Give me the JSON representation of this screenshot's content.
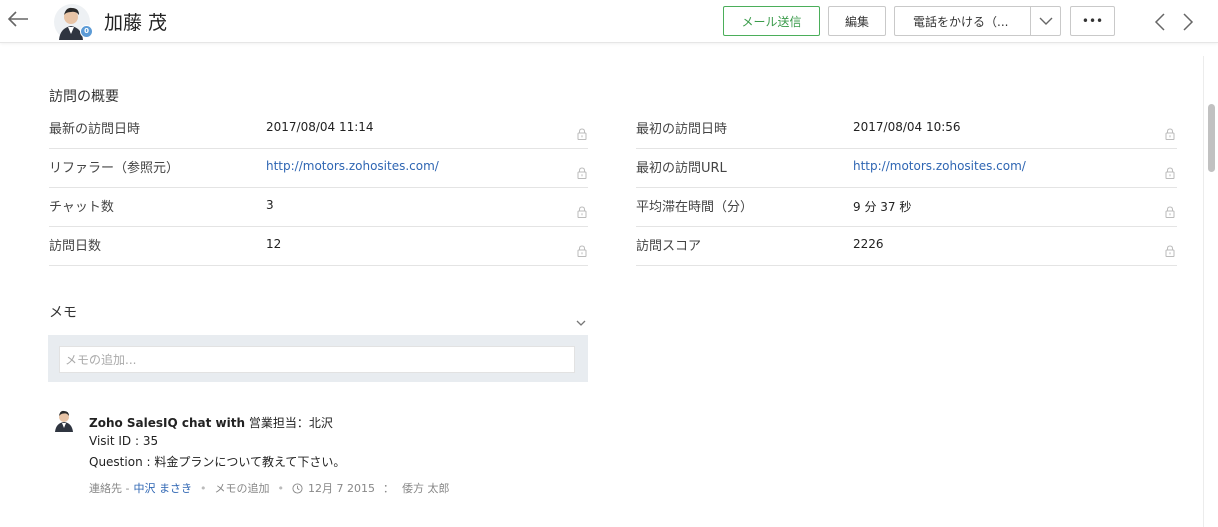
{
  "header": {
    "contact_name": "加藤 茂",
    "avatar_badge": "0",
    "send_mail_label": "メール送信",
    "edit_label": "編集",
    "call_label": "電話をかける（...",
    "more_label": "•••"
  },
  "visit_summary": {
    "title": "訪問の概要",
    "left": [
      {
        "label": "最新の訪問日時",
        "value": "2017/08/04 11:14",
        "link": false
      },
      {
        "label": "リファラー（参照元）",
        "value": "http://motors.zohosites.com/",
        "link": true
      },
      {
        "label": "チャット数",
        "value": "3",
        "link": false
      },
      {
        "label": "訪問日数",
        "value": "12",
        "link": false
      }
    ],
    "right": [
      {
        "label": "最初の訪問日時",
        "value": "2017/08/04 10:56",
        "link": false
      },
      {
        "label": "最初の訪問URL",
        "value": "http://motors.zohosites.com/",
        "link": true
      },
      {
        "label": "平均滞在時間（分）",
        "value": "9 分 37 秒",
        "link": false
      },
      {
        "label": "訪問スコア",
        "value": "2226",
        "link": false
      }
    ]
  },
  "memo": {
    "title": "メモ",
    "placeholder": "メモの追加..."
  },
  "note": {
    "title_bold": "Zoho SalesIQ chat with",
    "title_rest": " 営業担当：北沢",
    "line2": "Visit ID : 35",
    "line3": "Question : 料金プランについて教えて下さい。",
    "meta_contact_prefix": "連絡先 -",
    "meta_contact_name": "中沢 まさき",
    "meta_add_memo": "メモの追加",
    "meta_date": "12月 7 2015",
    "meta_sep": "：",
    "meta_author": "倭方 太郎"
  },
  "colors": {
    "accent_green": "#3a9b4a",
    "link_blue": "#2f66b3",
    "memo_bg": "#e8ecf0"
  }
}
